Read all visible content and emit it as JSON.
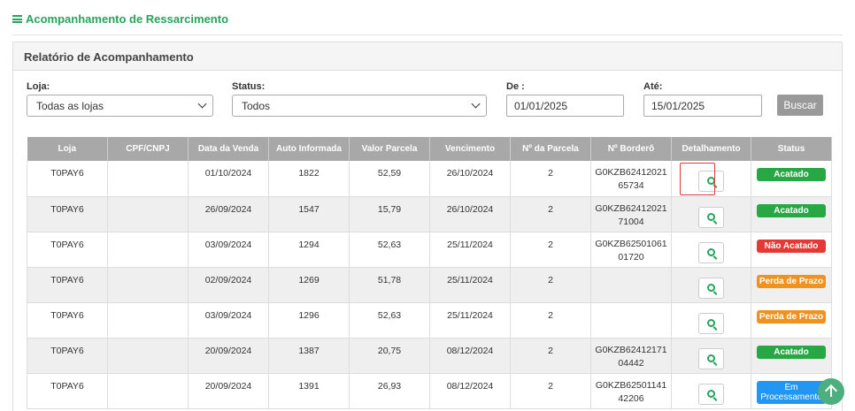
{
  "page": {
    "title": "Acompanhamento de Ressarcimento"
  },
  "panel": {
    "title": "Relatório de Acompanhamento"
  },
  "filters": {
    "loja": {
      "label": "Loja:",
      "value": "Todas as lojas"
    },
    "status": {
      "label": "Status:",
      "value": "Todos"
    },
    "de": {
      "label": "De :",
      "value": "01/01/2025"
    },
    "ate": {
      "label": "Até:",
      "value": "15/01/2025"
    },
    "search_label": "Buscar"
  },
  "table": {
    "headers": [
      "Loja",
      "CPF/CNPJ",
      "Data da Venda",
      "Auto Informada",
      "Valor Parcela",
      "Vencimento",
      "Nº da Parcela",
      "Nº Borderô",
      "Detalhamento",
      "Status"
    ],
    "rows": [
      {
        "loja": "T0PAY6",
        "cpf": "",
        "data_venda": "01/10/2024",
        "auto": "1822",
        "valor": "52,59",
        "vencimento": "26/10/2024",
        "parcela": "2",
        "bordero1": "G0KZB62412021",
        "bordero2": "65734",
        "status": "Acatado",
        "status_color": "#28a745"
      },
      {
        "loja": "T0PAY6",
        "cpf": "",
        "data_venda": "26/09/2024",
        "auto": "1547",
        "valor": "15,79",
        "vencimento": "26/10/2024",
        "parcela": "2",
        "bordero1": "G0KZB62412021",
        "bordero2": "71004",
        "status": "Acatado",
        "status_color": "#28a745"
      },
      {
        "loja": "T0PAY6",
        "cpf": "",
        "data_venda": "03/09/2024",
        "auto": "1294",
        "valor": "52,63",
        "vencimento": "25/11/2024",
        "parcela": "2",
        "bordero1": "G0KZB62501061",
        "bordero2": "01720",
        "status": "Não Acatado",
        "status_color": "#e53935"
      },
      {
        "loja": "T0PAY6",
        "cpf": "",
        "data_venda": "02/09/2024",
        "auto": "1269",
        "valor": "51,78",
        "vencimento": "25/11/2024",
        "parcela": "2",
        "bordero1": "",
        "bordero2": "",
        "status": "Perda de Prazo",
        "status_color": "#f0921e"
      },
      {
        "loja": "T0PAY6",
        "cpf": "",
        "data_venda": "03/09/2024",
        "auto": "1296",
        "valor": "52,63",
        "vencimento": "25/11/2024",
        "parcela": "2",
        "bordero1": "",
        "bordero2": "",
        "status": "Perda de Prazo",
        "status_color": "#f0921e"
      },
      {
        "loja": "T0PAY6",
        "cpf": "",
        "data_venda": "20/09/2024",
        "auto": "1387",
        "valor": "20,75",
        "vencimento": "08/12/2024",
        "parcela": "2",
        "bordero1": "G0KZB62412171",
        "bordero2": "04442",
        "status": "Acatado",
        "status_color": "#28a745"
      },
      {
        "loja": "T0PAY6",
        "cpf": "",
        "data_venda": "20/09/2024",
        "auto": "1391",
        "valor": "26,93",
        "vencimento": "08/12/2024",
        "parcela": "2",
        "bordero1": "G0KZB62501141",
        "bordero2": "42206",
        "status1": "Em",
        "status2": "Processamento",
        "status_color": "#2196f3"
      }
    ]
  },
  "colors": {
    "accent": "#27a35c",
    "header_bg": "#a8a8a8"
  },
  "icons": {
    "menu": "menu-icon",
    "detail": "search-icon",
    "scroll": "arrow-up-icon"
  }
}
